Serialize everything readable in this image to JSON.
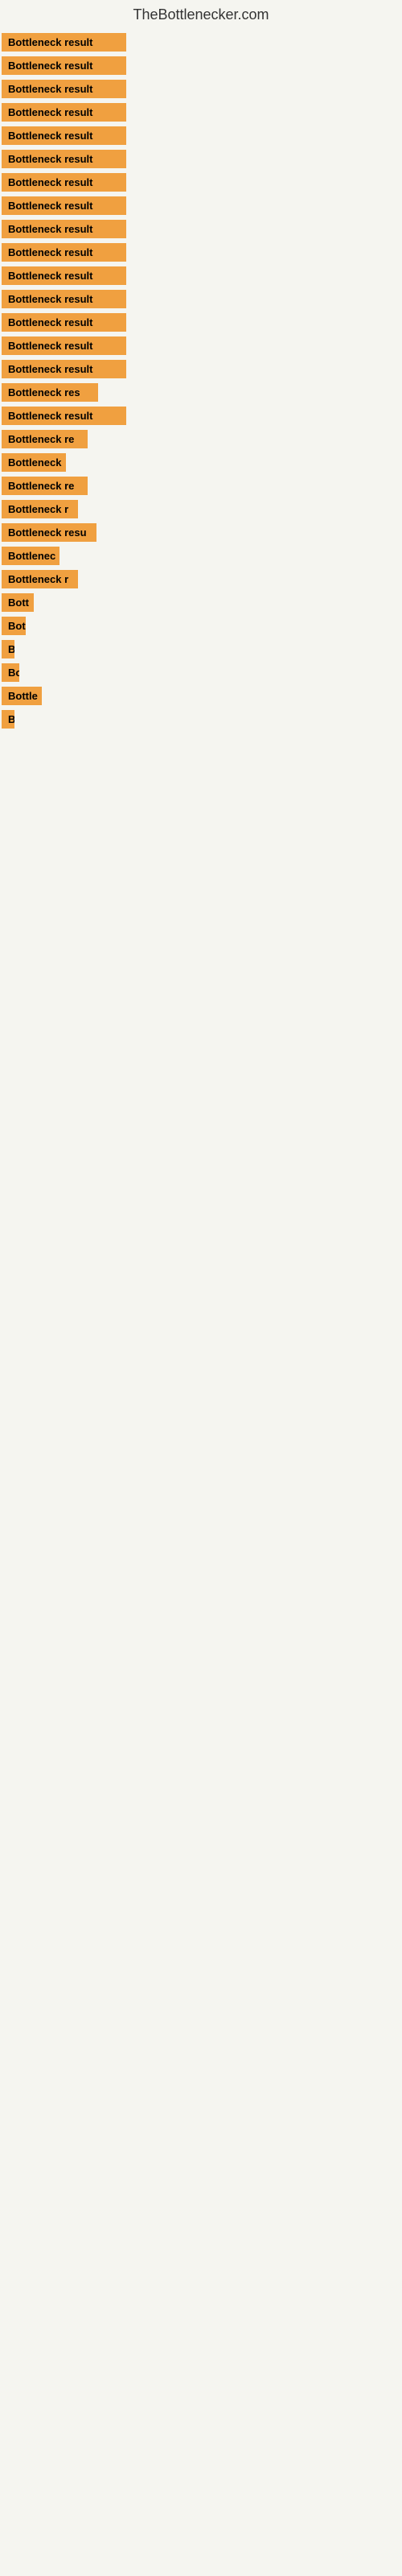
{
  "header": {
    "title": "TheBottlenecker.com"
  },
  "rows": [
    {
      "label": "Bottleneck result",
      "width": 155
    },
    {
      "label": "Bottleneck result",
      "width": 155
    },
    {
      "label": "Bottleneck result",
      "width": 155
    },
    {
      "label": "Bottleneck result",
      "width": 155
    },
    {
      "label": "Bottleneck result",
      "width": 155
    },
    {
      "label": "Bottleneck result",
      "width": 155
    },
    {
      "label": "Bottleneck result",
      "width": 155
    },
    {
      "label": "Bottleneck result",
      "width": 155
    },
    {
      "label": "Bottleneck result",
      "width": 155
    },
    {
      "label": "Bottleneck result",
      "width": 155
    },
    {
      "label": "Bottleneck result",
      "width": 155
    },
    {
      "label": "Bottleneck result",
      "width": 155
    },
    {
      "label": "Bottleneck result",
      "width": 155
    },
    {
      "label": "Bottleneck result",
      "width": 155
    },
    {
      "label": "Bottleneck result",
      "width": 155
    },
    {
      "label": "Bottleneck res",
      "width": 120
    },
    {
      "label": "Bottleneck result",
      "width": 155
    },
    {
      "label": "Bottleneck re",
      "width": 107
    },
    {
      "label": "Bottleneck",
      "width": 80
    },
    {
      "label": "Bottleneck re",
      "width": 107
    },
    {
      "label": "Bottleneck r",
      "width": 95
    },
    {
      "label": "Bottleneck resu",
      "width": 118
    },
    {
      "label": "Bottlenec",
      "width": 72
    },
    {
      "label": "Bottleneck r",
      "width": 95
    },
    {
      "label": "Bott",
      "width": 40
    },
    {
      "label": "Bot",
      "width": 30
    },
    {
      "label": "B",
      "width": 12
    },
    {
      "label": "Bo",
      "width": 22
    },
    {
      "label": "Bottle",
      "width": 50
    },
    {
      "label": "B",
      "width": 12
    }
  ]
}
